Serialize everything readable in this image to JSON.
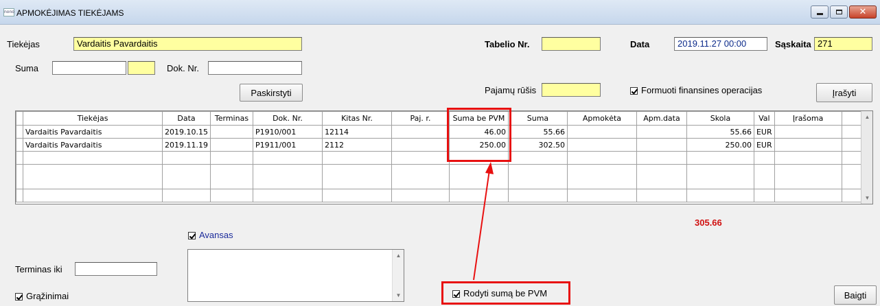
{
  "window": {
    "logo_text": "nono",
    "title": "APMOKĖJIMAS TIEKĖJAMS"
  },
  "form": {
    "supplier_label": "Tiekėjas",
    "supplier_value": "Vardaitis Pavardaitis",
    "tabelio_label": "Tabelio Nr.",
    "tabelio_value": "",
    "date_label": "Data",
    "date_value": "2019.11.27 00:00",
    "account_label": "Sąskaita",
    "account_value": "271",
    "suma_label": "Suma",
    "suma_value": "",
    "suma_small_value": "",
    "doc_label": "Dok. Nr.",
    "doc_value": "",
    "distribute_button": "Paskirstyti",
    "income_type_label": "Pajamų rūšis",
    "income_type_value": "",
    "form_ops_label": "Formuoti finansines operacijas",
    "form_ops_checked": true,
    "save_button": "Įrašyti"
  },
  "table": {
    "columns": [
      "Tiekėjas",
      "Data",
      "Terminas",
      "Dok. Nr.",
      "Kitas Nr.",
      "Paj. r.",
      "Suma be PVM",
      "Suma",
      "Apmokėta",
      "Apm.data",
      "Skola",
      "Val",
      "Įrašoma"
    ],
    "rows": [
      [
        "Vardaitis Pavardaitis",
        "2019.10.15",
        "",
        "P1910/001",
        "12114",
        "",
        "46.00",
        "55.66",
        "",
        "",
        "55.66",
        "EUR",
        ""
      ],
      [
        "Vardaitis Pavardaitis",
        "2019.11.19",
        "",
        "P1911/001",
        "2112",
        "",
        "250.00",
        "302.50",
        "",
        "",
        "250.00",
        "EUR",
        ""
      ]
    ]
  },
  "footer": {
    "total": "305.66",
    "total_color": "#d01010",
    "avansas_label": "Avansas",
    "avansas_checked": true,
    "term_label": "Terminas iki",
    "term_value": "",
    "returns_label": "Grąžinimai",
    "returns_checked": true,
    "show_without_vat_label": "Rodyti sumą be PVM",
    "show_without_vat_checked": true,
    "finish_button": "Baigti"
  },
  "annotation_color": "#e81010"
}
